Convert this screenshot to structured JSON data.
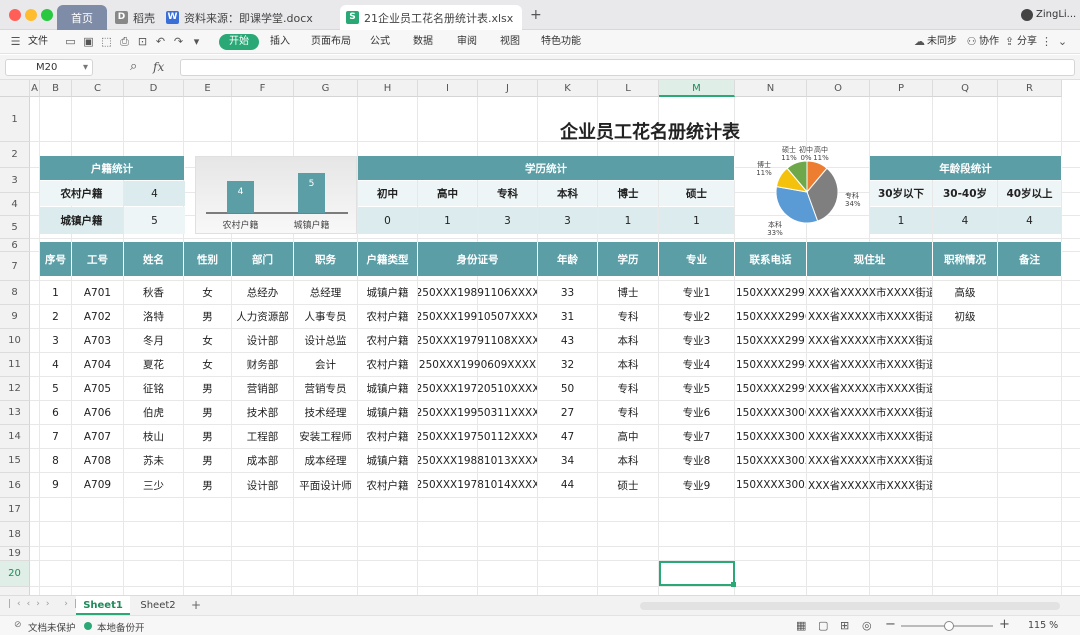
{
  "window": {
    "tabs": [
      {
        "label": "首页"
      },
      {
        "label": "稻壳",
        "icon": "d"
      },
      {
        "label": "资料来源：即课学堂.docx",
        "icon": "w"
      },
      {
        "label": "21企业员工花名册统计表.xlsx",
        "icon": "s"
      }
    ],
    "user": "ZingLi..."
  },
  "menu": {
    "file": "文件",
    "items": [
      "开始",
      "插入",
      "页面布局",
      "公式",
      "数据",
      "审阅",
      "视图",
      "特色功能"
    ],
    "right": [
      "未同步",
      "协作",
      "分享"
    ]
  },
  "formula": {
    "cell_ref": "M20",
    "fx": "fx",
    "value": ""
  },
  "columns": [
    "A",
    "B",
    "C",
    "D",
    "E",
    "F",
    "G",
    "H",
    "I",
    "J",
    "K",
    "L",
    "M",
    "N",
    "O",
    "P",
    "Q",
    "R"
  ],
  "rows": [
    "1",
    "2",
    "3",
    "4",
    "5",
    "6",
    "7",
    "8",
    "9",
    "10",
    "11",
    "12",
    "13",
    "14",
    "15",
    "16",
    "17",
    "18",
    "19",
    "20",
    "21"
  ],
  "sheet": {
    "title": "企业员工花名册统计表",
    "huji": {
      "header": "户籍统计",
      "rows": [
        {
          "label": "农村户籍",
          "value": "4"
        },
        {
          "label": "城镇户籍",
          "value": "5"
        }
      ]
    },
    "xueli": {
      "header": "学历统计",
      "labels": [
        "初中",
        "高中",
        "专科",
        "本科",
        "博士",
        "硕士"
      ],
      "values": [
        "0",
        "1",
        "3",
        "3",
        "1",
        "1"
      ]
    },
    "age": {
      "header": "年龄段统计",
      "labels": [
        "30岁以下",
        "30-40岁",
        "40岁以上"
      ],
      "values": [
        "1",
        "4",
        "4"
      ]
    },
    "table_headers": [
      "序号",
      "工号",
      "姓名",
      "性别",
      "部门",
      "职务",
      "户籍类型",
      "身份证号",
      "年龄",
      "学历",
      "专业",
      "联系电话",
      "现住址",
      "职称情况",
      "备注"
    ],
    "table_rows": [
      [
        "1",
        "A701",
        "秋香",
        "女",
        "总经办",
        "总经理",
        "城镇户籍",
        "250XXX19891106XXXX",
        "33",
        "博士",
        "专业1",
        "150XXXX2995",
        "XXX省XXXXX市XXXX街道",
        "高级",
        ""
      ],
      [
        "2",
        "A702",
        "洛特",
        "男",
        "人力资源部",
        "人事专员",
        "农村户籍",
        "250XXX19910507XXXX",
        "31",
        "专科",
        "专业2",
        "150XXXX2996",
        "XXX省XXXXX市XXXX街道",
        "初级",
        ""
      ],
      [
        "3",
        "A703",
        "冬月",
        "女",
        "设计部",
        "设计总监",
        "农村户籍",
        "250XXX19791108XXXX",
        "43",
        "本科",
        "专业3",
        "150XXXX2997",
        "XXX省XXXXX市XXXX街道",
        "",
        ""
      ],
      [
        "4",
        "A704",
        "夏花",
        "女",
        "财务部",
        "会计",
        "农村户籍",
        "250XXX1990609XXXX",
        "32",
        "本科",
        "专业4",
        "150XXXX2998",
        "XXX省XXXXX市XXXX街道",
        "",
        ""
      ],
      [
        "5",
        "A705",
        "征铭",
        "男",
        "营销部",
        "营销专员",
        "城镇户籍",
        "250XXX19720510XXXX",
        "50",
        "专科",
        "专业5",
        "150XXXX2999",
        "XXX省XXXXX市XXXX街道",
        "",
        ""
      ],
      [
        "6",
        "A706",
        "伯虎",
        "男",
        "技术部",
        "技术经理",
        "城镇户籍",
        "250XXX19950311XXXX",
        "27",
        "专科",
        "专业6",
        "150XXXX3000",
        "XXX省XXXXX市XXXX街道",
        "",
        ""
      ],
      [
        "7",
        "A707",
        "枝山",
        "男",
        "工程部",
        "安装工程师",
        "农村户籍",
        "250XXX19750112XXXX",
        "47",
        "高中",
        "专业7",
        "150XXXX3001",
        "XXX省XXXXX市XXXX街道",
        "",
        ""
      ],
      [
        "8",
        "A708",
        "苏未",
        "男",
        "成本部",
        "成本经理",
        "城镇户籍",
        "250XXX19881013XXXX",
        "34",
        "本科",
        "专业8",
        "150XXXX3002",
        "XXX省XXXXX市XXXX街道",
        "",
        ""
      ],
      [
        "9",
        "A709",
        "三少",
        "男",
        "设计部",
        "平面设计师",
        "农村户籍",
        "250XXX19781014XXXX",
        "44",
        "硕士",
        "专业9",
        "150XXXX3003",
        "XXX省XXXXX市XXXX街道",
        "",
        ""
      ]
    ]
  },
  "chart_data": [
    {
      "type": "bar",
      "categories": [
        "农村户籍",
        "城镇户籍"
      ],
      "values": [
        4,
        5
      ],
      "color": "#5b9ea6"
    },
    {
      "type": "pie",
      "slices": [
        {
          "label": "硕士",
          "value": 1,
          "pct": "11%",
          "color": "#6fa84a"
        },
        {
          "label": "初中",
          "value": 0,
          "pct": "0%",
          "color": "#4e79a7"
        },
        {
          "label": "高中",
          "value": 1,
          "pct": "11%",
          "color": "#ed7d31"
        },
        {
          "label": "专科",
          "value": 3,
          "pct": "34%",
          "color": "#7f7f7f"
        },
        {
          "label": "本科",
          "value": 3,
          "pct": "33%",
          "color": "#5b9bd5"
        },
        {
          "label": "博士",
          "value": 1,
          "pct": "11%",
          "color": "#f4c20d"
        }
      ]
    }
  ],
  "sheets": [
    "Sheet1",
    "Sheet2"
  ],
  "status": {
    "left1": "文档未保护",
    "left2": "本地备份开",
    "zoom": "115 %"
  },
  "colors": {
    "teal": "#5b9ea6",
    "accent": "#2aa876"
  }
}
